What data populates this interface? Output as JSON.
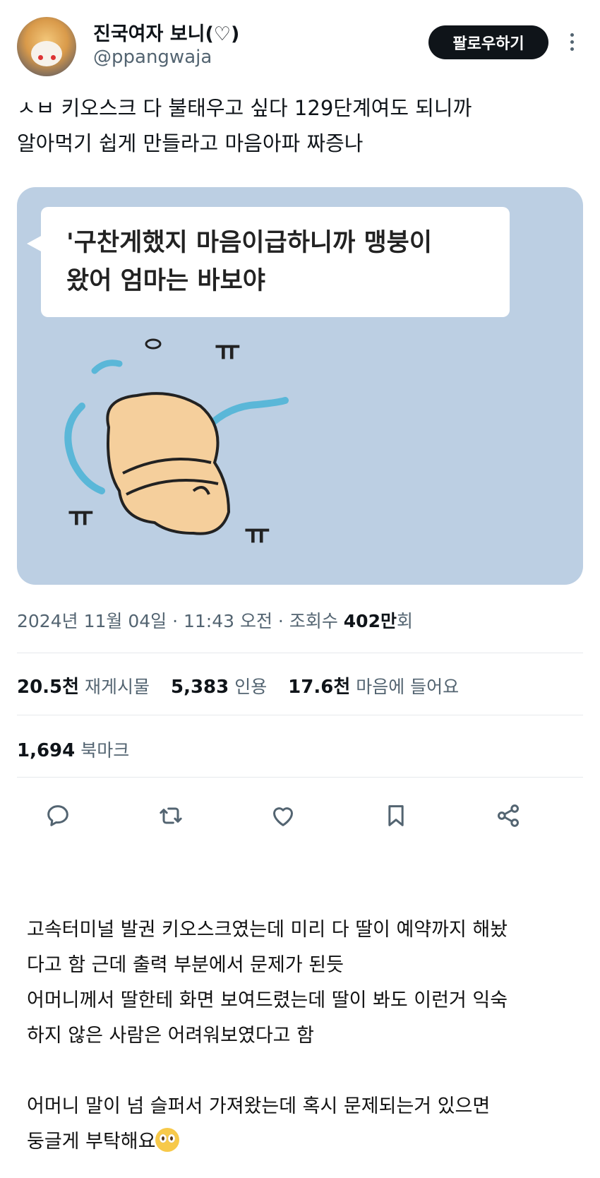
{
  "user": {
    "display_name": "진국여자 보니(♡)",
    "handle": "@ppangwaja",
    "follow_label": "팔로우하기"
  },
  "tweet": {
    "text_lines": [
      "ㅅㅂ 키오스크 다 불태우고 싶다 129단계여도 되니까",
      "알아먹기 쉽게 만들라고 마음아파 짜증나"
    ]
  },
  "media": {
    "bubble_lines": [
      "'구찬게했지 마음이급하니까 맹붕이",
      "왔어  엄마는 바보야"
    ],
    "tear_marks": [
      "ㅠ",
      "ㅠ",
      "ㅠ"
    ],
    "background_color": "#bccfe3",
    "character_color": "#f5cf9c"
  },
  "meta": {
    "date": "2024년 11월 04일",
    "sep1": " · ",
    "time": "11:43 오전",
    "sep2": " · ",
    "views_label": "조회수 ",
    "views_value": "402만",
    "views_suffix": "회"
  },
  "stats": {
    "reposts_value": "20.5천",
    "reposts_label": "재게시물",
    "quotes_value": "5,383",
    "quotes_label": "인용",
    "likes_value": "17.6천",
    "likes_label": "마음에 들어요",
    "bookmarks_value": "1,694",
    "bookmarks_label": "북마크"
  },
  "actions": {
    "reply": "reply-icon",
    "retweet": "retweet-icon",
    "like": "heart-icon",
    "bookmark": "bookmark-icon",
    "share": "share-icon",
    "icon_color": "#536471"
  },
  "body": {
    "paragraph1": [
      "고속터미널 발권 키오스크였는데 미리 다 딸이 예약까지 해놨",
      "다고 함 근데 출력 부분에서 문제가 된듯",
      "어머니께서 딸한테 화면 보여드렸는데 딸이 봐도 이런거 익숙",
      "하지 않은 사람은 어려워보였다고 함"
    ],
    "paragraph2_line1": "어머니 말이 넘 슬퍼서 가져왔는데 혹시 문제되는거 있으면",
    "paragraph2_line2": "둥글게 부탁해요",
    "emoji": "pleading-face-emoji"
  }
}
